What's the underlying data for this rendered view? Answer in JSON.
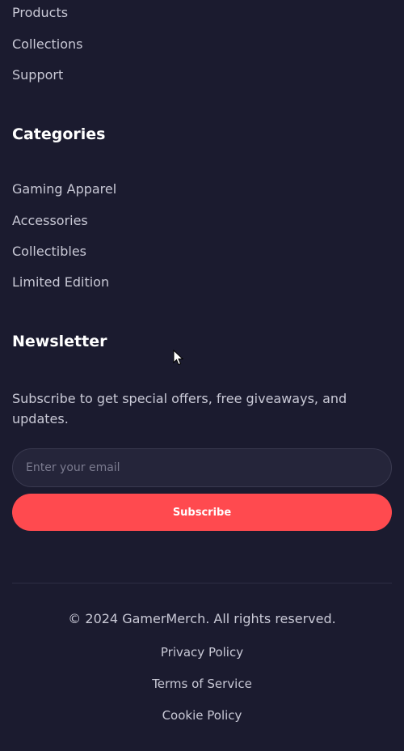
{
  "quick_links": {
    "items": [
      {
        "label": "Products"
      },
      {
        "label": "Collections"
      },
      {
        "label": "Support"
      }
    ]
  },
  "categories": {
    "title": "Categories",
    "items": [
      {
        "label": "Gaming Apparel"
      },
      {
        "label": "Accessories"
      },
      {
        "label": "Collectibles"
      },
      {
        "label": "Limited Edition"
      }
    ]
  },
  "newsletter": {
    "title": "Newsletter",
    "description": "Subscribe to get special offers, free giveaways, and updates.",
    "email_placeholder": "Enter your email",
    "email_value": "",
    "subscribe_label": "Subscribe"
  },
  "bottom": {
    "copyright": "© 2024 GamerMerch. All rights reserved.",
    "links": [
      {
        "label": "Privacy Policy"
      },
      {
        "label": "Terms of Service"
      },
      {
        "label": "Cookie Policy"
      }
    ]
  },
  "colors": {
    "background": "#1b1b2f",
    "text": "#c9c9d6",
    "heading": "#ffffff",
    "accent": "#ff4a4f",
    "input_bg": "#25253a"
  },
  "icons": {
    "cursor": "mouse-pointer-icon"
  }
}
